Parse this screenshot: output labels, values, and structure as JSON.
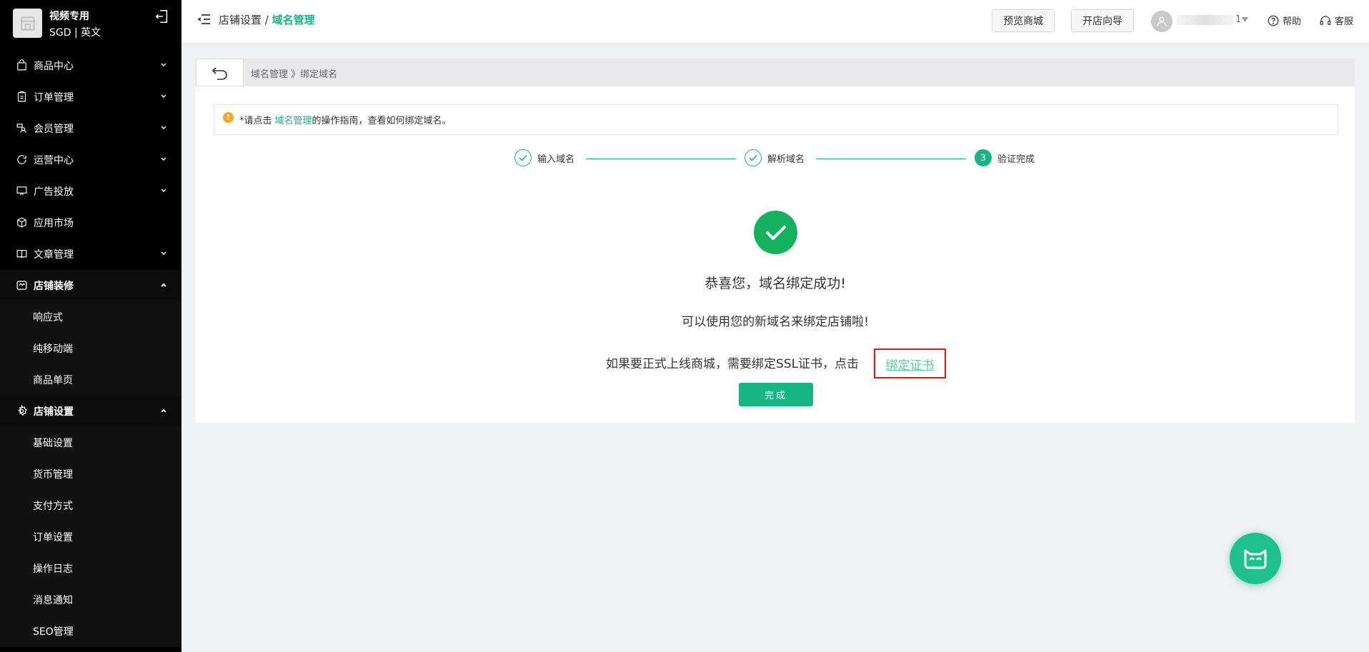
{
  "store": {
    "name": "视频专用",
    "currency_lang": "SGD | 英文"
  },
  "sidebar": {
    "items": [
      {
        "label": "商品中心",
        "icon": "bag-icon"
      },
      {
        "label": "订单管理",
        "icon": "clipboard-icon"
      },
      {
        "label": "会员管理",
        "icon": "members-icon"
      },
      {
        "label": "运营中心",
        "icon": "refresh-icon"
      },
      {
        "label": "广告投放",
        "icon": "screen-icon"
      },
      {
        "label": "应用市场",
        "icon": "cube-icon"
      },
      {
        "label": "文章管理",
        "icon": "book-icon"
      }
    ],
    "decor": {
      "label": "店铺装修",
      "subs": [
        "响应式",
        "纯移动端",
        "商品单页"
      ]
    },
    "settings": {
      "label": "店铺设置",
      "subs": [
        "基础设置",
        "货币管理",
        "支付方式",
        "订单设置",
        "操作日志",
        "消息通知",
        "SEO管理"
      ]
    }
  },
  "header": {
    "crumb_parent": "店铺设置 /",
    "crumb_current": "域名管理",
    "preview_label": "预览商城",
    "guide_label": "开店向导",
    "user_suffix": "1",
    "help_label": "帮助",
    "service_label": "客服"
  },
  "subbar": {
    "crumb": "域名管理 》绑定域名"
  },
  "notice": {
    "prefix": "*请点击",
    "link": "域名管理",
    "suffix": "的操作指南，查看如何绑定域名。"
  },
  "steps": [
    {
      "label": "输入域名",
      "state": "done"
    },
    {
      "label": "解析域名",
      "state": "done"
    },
    {
      "label": "验证完成",
      "state": "current",
      "number": "3"
    }
  ],
  "result": {
    "title": "恭喜您，域名绑定成功!",
    "subtitle": "可以使用您的新域名来绑定店铺啦!",
    "ssl_text": "如果要正式上线商城，需要绑定SSL证书，点击",
    "ssl_link": "绑定证书",
    "done_label": "完成"
  },
  "colors": {
    "accent": "#16b583",
    "success": "#14b25f",
    "highlight_box": "#e11111",
    "warning": "#f5a623"
  }
}
